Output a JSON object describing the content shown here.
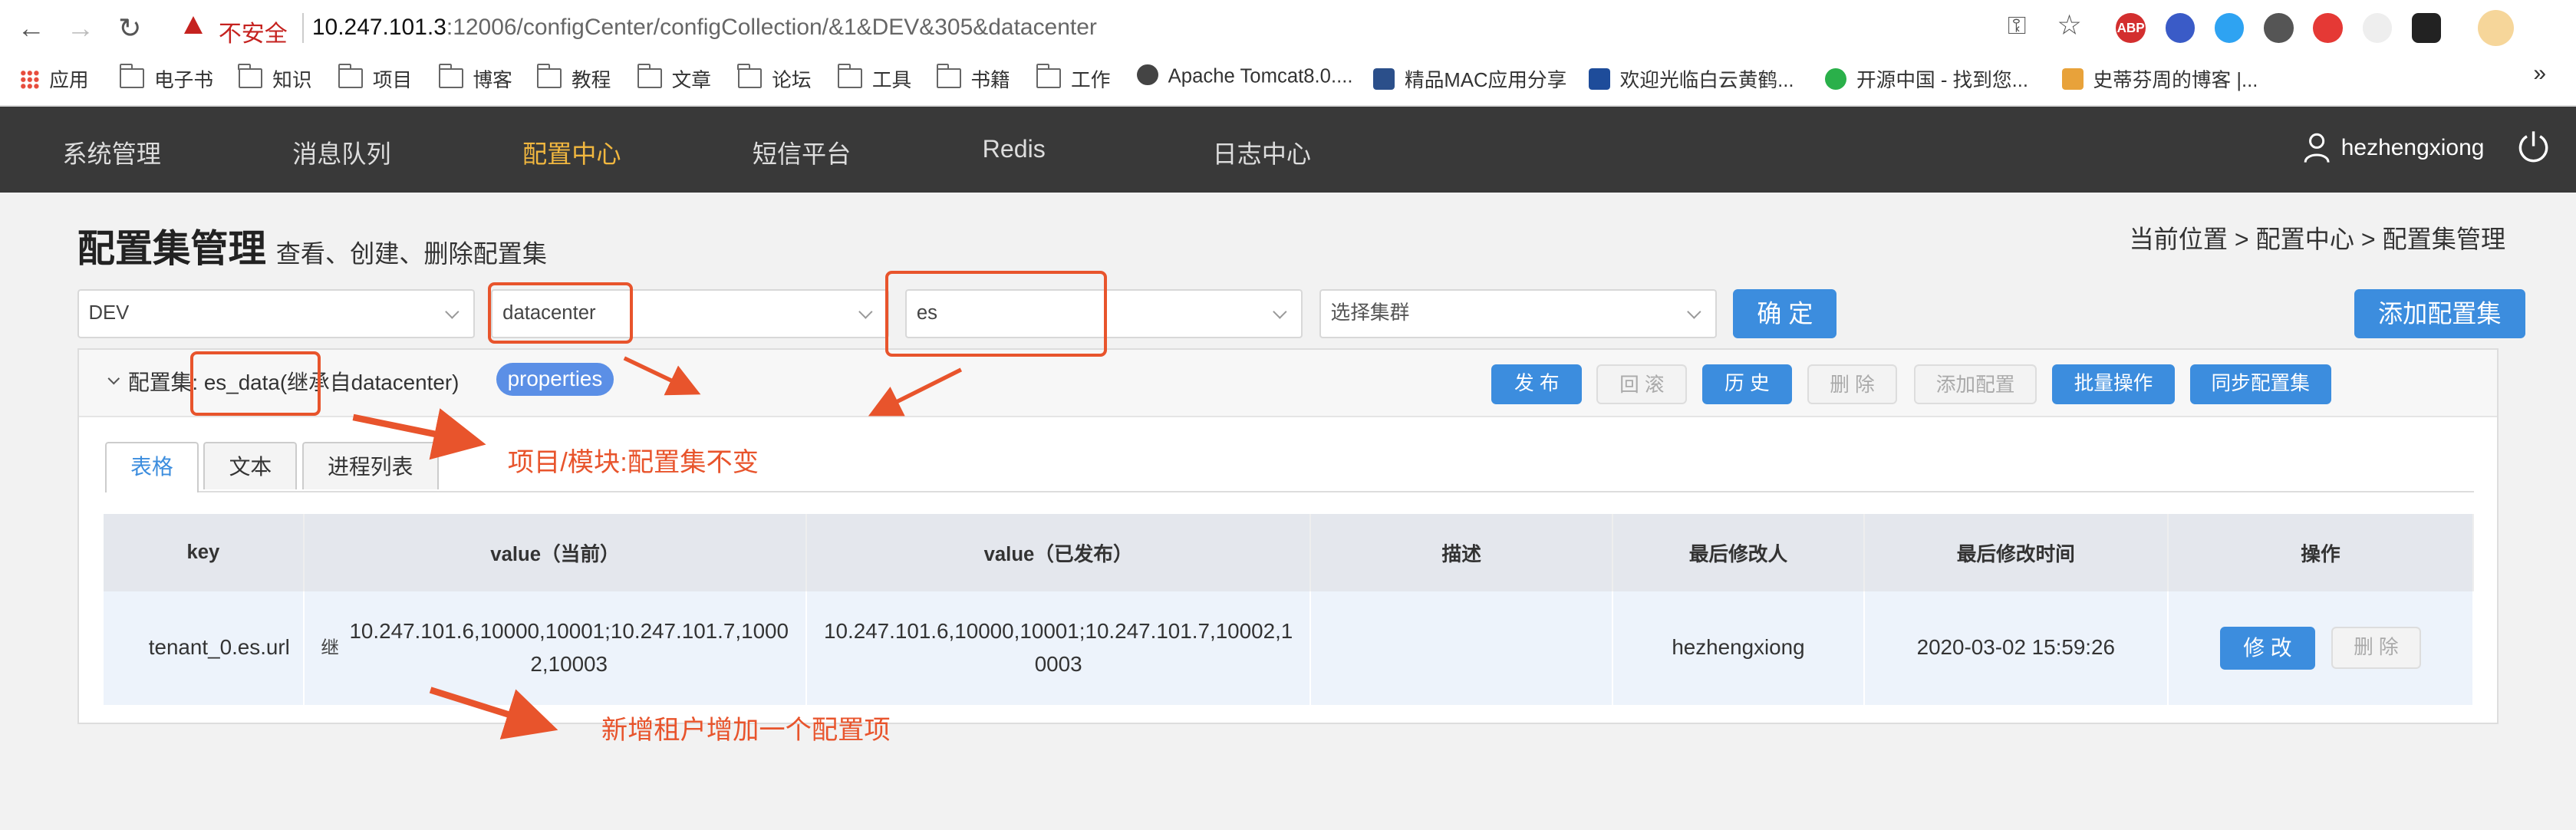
{
  "browser": {
    "security_label": "不安全",
    "url_host": "10.247.101.3",
    "url_rest": ":12006/configCenter/configCollection/&1&DEV&305&datacenter",
    "bookmarks": [
      "应用",
      "电子书",
      "知识",
      "项目",
      "博客",
      "教程",
      "文章",
      "论坛",
      "工具",
      "书籍",
      "工作",
      "Apache Tomcat8.0....",
      "精品MAC应用分享",
      "欢迎光临白云黄鹤...",
      "开源中国 - 找到您...",
      "史蒂芬周的博客 |..."
    ],
    "more": "»",
    "extensions": [
      "ABP"
    ]
  },
  "nav": {
    "items": [
      "系统管理",
      "消息队列",
      "配置中心",
      "短信平台",
      "Redis",
      "日志中心"
    ],
    "active_index": 2,
    "username": "hezhengxiong"
  },
  "header": {
    "title": "配置集管理",
    "subtitle": "查看、创建、删除配置集",
    "breadcrumb": "当前位置 > 配置中心 > 配置集管理"
  },
  "filters": {
    "env": "DEV",
    "project": "datacenter",
    "module": "es",
    "cluster_placeholder": "选择集群",
    "confirm": "确 定",
    "add_config_set": "添加配置集"
  },
  "panel": {
    "label_prefix": "配置集:",
    "name": "es_data",
    "inherit": "(继承自datacenter)",
    "tag": "properties",
    "buttons": {
      "publish": "发 布",
      "rollback": "回 滚",
      "history": "历 史",
      "delete": "删 除",
      "add_config": "添加配置",
      "batch": "批量操作",
      "sync": "同步配置集"
    },
    "tabs": [
      "表格",
      "文本",
      "进程列表"
    ],
    "columns": [
      "key",
      "value（当前）",
      "value（已发布）",
      "描述",
      "最后修改人",
      "最后修改时间",
      "操作"
    ],
    "rows": [
      {
        "key": "tenant_0.es.url",
        "inherit_mark": "继",
        "value_current": "10.247.101.6,10000,10001;10.247.101.7,10002,10003",
        "value_published": "10.247.101.6,10000,10001;10.247.101.7,10002,10003",
        "desc": "",
        "modifier": "hezhengxiong",
        "modified_time": "2020-03-02 15:59:26",
        "edit": "修 改",
        "delete": "删 除"
      }
    ]
  },
  "annotations": {
    "note1": "项目/模块:配置集不变",
    "note2": "新增租户增加一个配置项"
  },
  "colors": {
    "nav_bg": "#393939",
    "nav_active": "#f1b73f",
    "primary": "#3c8dde",
    "annotation": "#e8542c"
  }
}
